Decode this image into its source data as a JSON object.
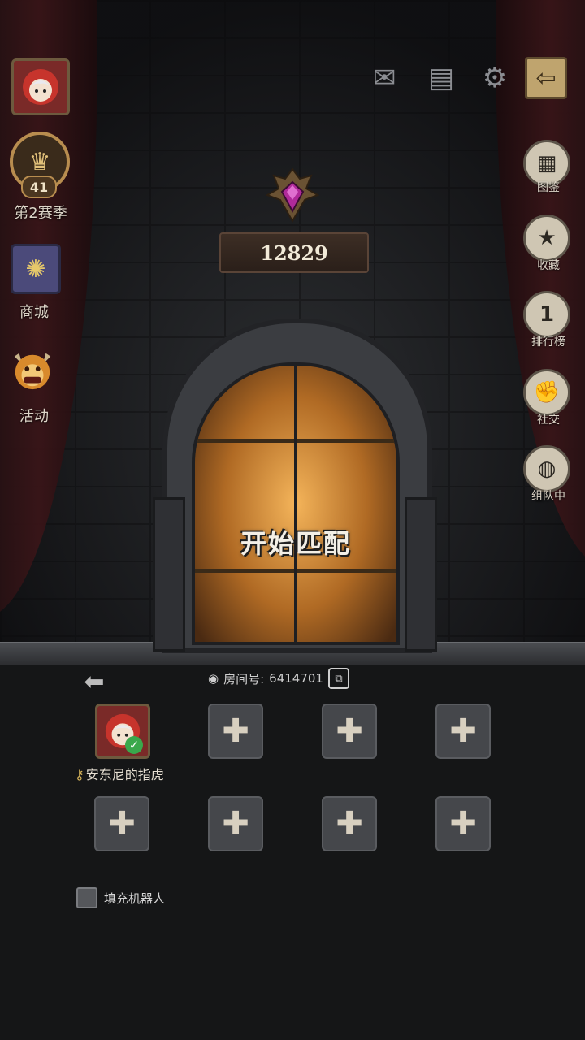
{
  "top_bar": {
    "avatar_icon": "player-avatar",
    "mail_icon": "✉",
    "notes_icon": "▤",
    "settings_icon": "⚙",
    "exit_icon": "⇦"
  },
  "left_menu": {
    "season_level": "41",
    "season_label": "第2赛季",
    "shop_label": "商城",
    "event_label": "活动"
  },
  "right_menu": {
    "items": [
      {
        "label": "图鉴",
        "icon": "▦"
      },
      {
        "label": "收藏",
        "icon": "★"
      },
      {
        "label": "排行榜",
        "icon": "1"
      },
      {
        "label": "社交",
        "icon": "✊"
      },
      {
        "label": "组队中",
        "icon": "◍"
      }
    ]
  },
  "rank": {
    "score": "12829"
  },
  "door": {
    "start_label": "开始匹配"
  },
  "room": {
    "room_label": "房间号:",
    "room_number": "6414701"
  },
  "party": {
    "member_name": "安东尼的指虎",
    "add_symbol": "✚",
    "empty_slots": 7
  },
  "options": {
    "fill_bots_label": "填充机器人",
    "fill_bots_checked": false
  },
  "colors": {
    "accent_gold": "#b88d4f",
    "door_glow": "#f4b45a",
    "gem_magenta": "#b02a9a"
  }
}
